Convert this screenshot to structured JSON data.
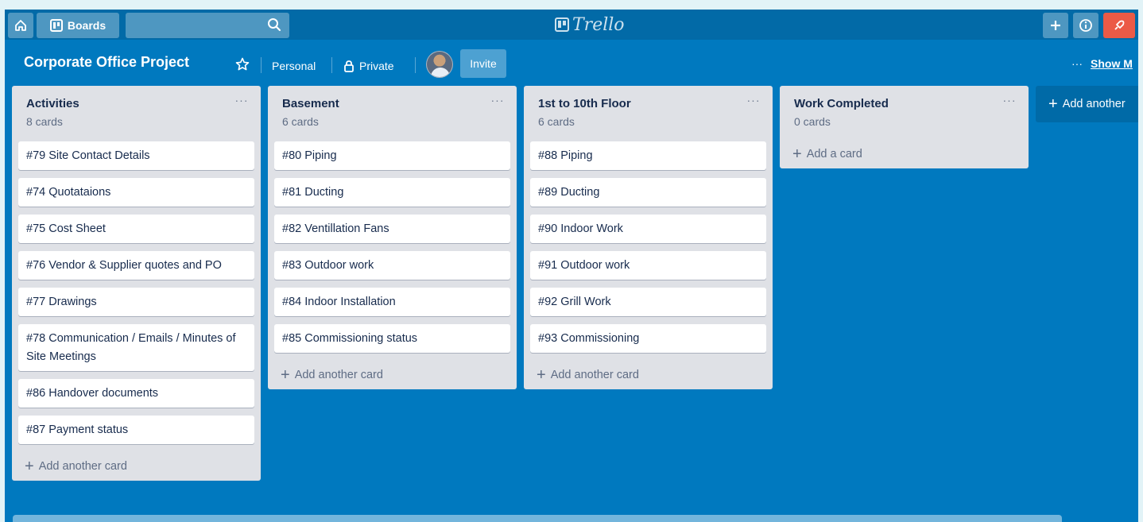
{
  "header": {
    "boards_label": "Boards",
    "logo_text": "Trello"
  },
  "board": {
    "title": "Corporate Office Project",
    "team": "Personal",
    "visibility": "Private",
    "invite_label": "Invite",
    "show_menu_label": "Show M"
  },
  "lists": [
    {
      "title": "Activities",
      "count": "8 cards",
      "cards": [
        "#79 Site Contact Details",
        "#74 Quotataions",
        "#75 Cost Sheet",
        "#76 Vendor & Supplier quotes and PO",
        "#77 Drawings",
        "#78 Communication / Emails / Minutes of Site Meetings",
        "#86 Handover documents",
        "#87 Payment status"
      ],
      "add_label": "Add another card"
    },
    {
      "title": "Basement",
      "count": "6 cards",
      "cards": [
        "#80 Piping",
        "#81 Ducting",
        "#82 Ventillation Fans",
        "#83 Outdoor work",
        "#84 Indoor Installation",
        "#85 Commissioning status"
      ],
      "add_label": "Add another card"
    },
    {
      "title": "1st to 10th Floor",
      "count": "6 cards",
      "cards": [
        "#88 Piping",
        "#89 Ducting",
        "#90 Indoor Work",
        "#91 Outdoor work",
        "#92 Grill Work",
        "#93 Commissioning"
      ],
      "add_label": "Add another card"
    },
    {
      "title": "Work Completed",
      "count": "0 cards",
      "cards": [],
      "add_label": "Add a card"
    }
  ],
  "add_list_label": "Add another",
  "colors": {
    "board_bg": "#0079bf",
    "header_bg": "#026aa7",
    "list_bg": "#dfe1e6",
    "notification": "#eb5a46"
  }
}
